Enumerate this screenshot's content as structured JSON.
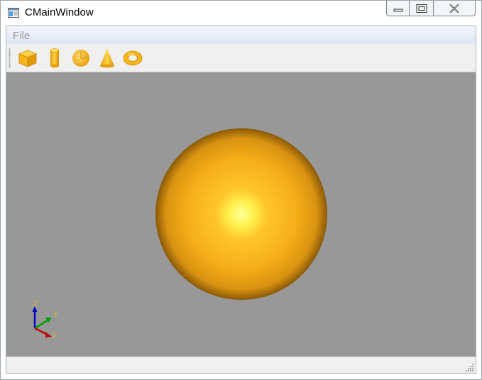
{
  "window": {
    "title": "CMainWindow",
    "icon": "app-window-icon",
    "buttons": {
      "minimize": "minimize-icon",
      "maximize": "maximize-icon",
      "close": "close-icon"
    }
  },
  "menubar": {
    "items": [
      {
        "label": "File"
      }
    ]
  },
  "toolbar": {
    "tools": [
      {
        "name": "box",
        "icon": "box-icon"
      },
      {
        "name": "cylinder",
        "icon": "cylinder-icon"
      },
      {
        "name": "sphere",
        "icon": "sphere-icon"
      },
      {
        "name": "cone",
        "icon": "cone-icon"
      },
      {
        "name": "torus",
        "icon": "torus-icon"
      }
    ]
  },
  "viewport": {
    "background_color": "#989898",
    "object": {
      "shape": "sphere",
      "color": "#ffb21e"
    },
    "axis_triad": {
      "x_label": "X",
      "y_label": "Y",
      "z_label": "Z"
    }
  },
  "colors": {
    "accent": "#f5b51a",
    "axis_x": "#c00000",
    "axis_y": "#00a000",
    "axis_z": "#0000c0"
  }
}
